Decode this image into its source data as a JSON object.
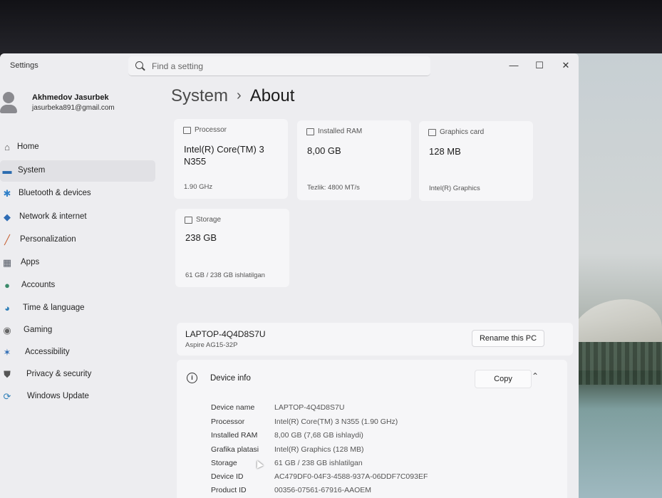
{
  "app": {
    "title": "Settings"
  },
  "search": {
    "placeholder": "Find a setting"
  },
  "window_controls": {
    "minimize": "—",
    "maximize": "☐",
    "close": "✕"
  },
  "profile": {
    "name": "Akhmedov Jasurbek",
    "email": "jasurbeka891@gmail.com"
  },
  "sidebar": {
    "items": [
      {
        "label": "Home",
        "icon": "home-icon",
        "active": false
      },
      {
        "label": "System",
        "icon": "system-icon",
        "active": true
      },
      {
        "label": "Bluetooth & devices",
        "icon": "bluetooth-icon",
        "active": false
      },
      {
        "label": "Network & internet",
        "icon": "wifi-icon",
        "active": false
      },
      {
        "label": "Personalization",
        "icon": "brush-icon",
        "active": false
      },
      {
        "label": "Apps",
        "icon": "apps-icon",
        "active": false
      },
      {
        "label": "Accounts",
        "icon": "accounts-icon",
        "active": false
      },
      {
        "label": "Time & language",
        "icon": "globe-clock-icon",
        "active": false
      },
      {
        "label": "Gaming",
        "icon": "gamepad-icon",
        "active": false
      },
      {
        "label": "Accessibility",
        "icon": "accessibility-icon",
        "active": false
      },
      {
        "label": "Privacy & security",
        "icon": "shield-icon",
        "active": false
      },
      {
        "label": "Windows Update",
        "icon": "update-icon",
        "active": false
      }
    ]
  },
  "breadcrumb": {
    "parent": "System",
    "separator": "›",
    "current": "About"
  },
  "cards": {
    "processor": {
      "title": "Processor",
      "value_line1": "Intel(R) Core(TM) 3",
      "value_line2": "N355",
      "sub": "1.90 GHz",
      "icon": "processor-icon"
    },
    "ram": {
      "title": "Installed RAM",
      "value": "8,00 GB",
      "sub": "Tezlik: 4800 MT/s",
      "icon": "ram-icon"
    },
    "graphics": {
      "title": "Graphics card",
      "value": "128 MB",
      "sub": "Intel(R) Graphics",
      "icon": "graphics-card-icon"
    },
    "storage": {
      "title": "Storage",
      "value": "238 GB",
      "sub": "61 GB / 238 GB ishlatilgan",
      "icon": "storage-icon"
    }
  },
  "pc": {
    "name": "LAPTOP-4Q4D8S7U",
    "model": "Aspire AG15-32P",
    "rename_label": "Rename this PC"
  },
  "device_info": {
    "title": "Device info",
    "copy_label": "Copy",
    "rows": [
      {
        "label": "Device name",
        "value": "LAPTOP-4Q4D8S7U"
      },
      {
        "label": "Processor",
        "value": "Intel(R) Core(TM) 3 N355 (1.90 GHz)"
      },
      {
        "label": "Installed RAM",
        "value": "8,00 GB (7,68 GB ishlaydi)"
      },
      {
        "label": "Grafika platasi",
        "value": "Intel(R) Graphics (128 MB)"
      },
      {
        "label": "Storage",
        "value": "61 GB / 238 GB ishlatilgan"
      },
      {
        "label": "Device ID",
        "value": "AC479DF0-04F3-4588-937A-06DDF7C093EF"
      },
      {
        "label": "Product ID",
        "value": "00356-07561-67916-AAOEM"
      }
    ]
  },
  "colors": {
    "window_bg": "#ededf0",
    "card_bg": "#f6f6f8",
    "active_nav_bg": "#e1e1e5"
  }
}
